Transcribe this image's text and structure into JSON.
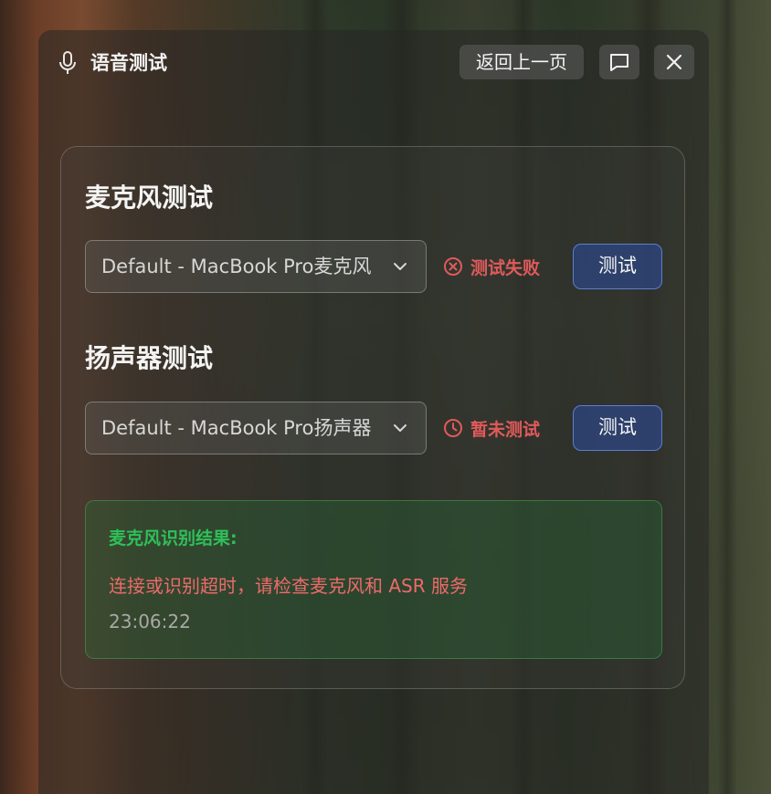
{
  "header": {
    "title": "语音测试",
    "back_label": "返回上一页",
    "icons": [
      "microphone-icon",
      "message-icon",
      "close-icon"
    ]
  },
  "microphone": {
    "section_title": "麦克风测试",
    "device": "Default - MacBook Pro麦克风",
    "status": "测试失败",
    "status_icon": "x-circle-icon",
    "test_label": "测试"
  },
  "speaker": {
    "section_title": "扬声器测试",
    "device": "Default - MacBook Pro扬声器",
    "status": "暂未测试",
    "status_icon": "clock-icon",
    "test_label": "测试"
  },
  "result": {
    "title": "麦克风识别结果:",
    "message": "连接或识别超时，请检查麦克风和 ASR 服务",
    "time": "23:06:22"
  },
  "colors": {
    "accent_blue": "#5a7fd0",
    "error_red": "#e05a5a",
    "success_green": "#2fbf5a"
  }
}
